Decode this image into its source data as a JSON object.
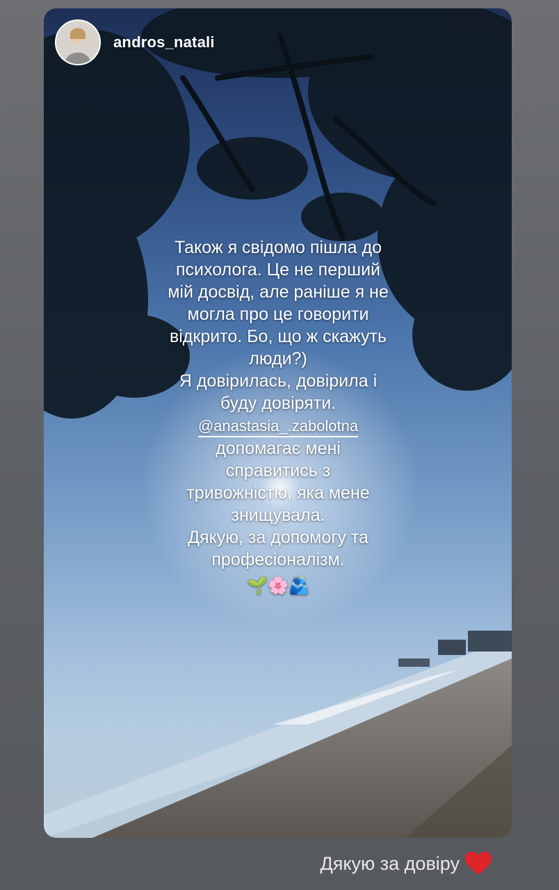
{
  "story": {
    "username": "andros_natali",
    "lines": [
      "Також я свідомо пішла до",
      "психолога. Це не перший",
      "мій досвід, але раніше я не",
      "могла про це говорити",
      "відкрито. Бо, що ж скажуть",
      "люди?)",
      "Я довірилась, довірила і",
      "буду довіряти."
    ],
    "mention": "@anastasia_.zabolotna",
    "lines_after": [
      "допомагає мені",
      "справитись з",
      "тривожністю, яка мене",
      "знищувала.",
      "Дякую, за допомогу та",
      "професіоналізм."
    ],
    "emojis": "🌱🌸🫂"
  },
  "reply": {
    "text": "Дякую за довіру",
    "heart_icon": "red-heart-icon",
    "heart_color": "#e0242c"
  }
}
